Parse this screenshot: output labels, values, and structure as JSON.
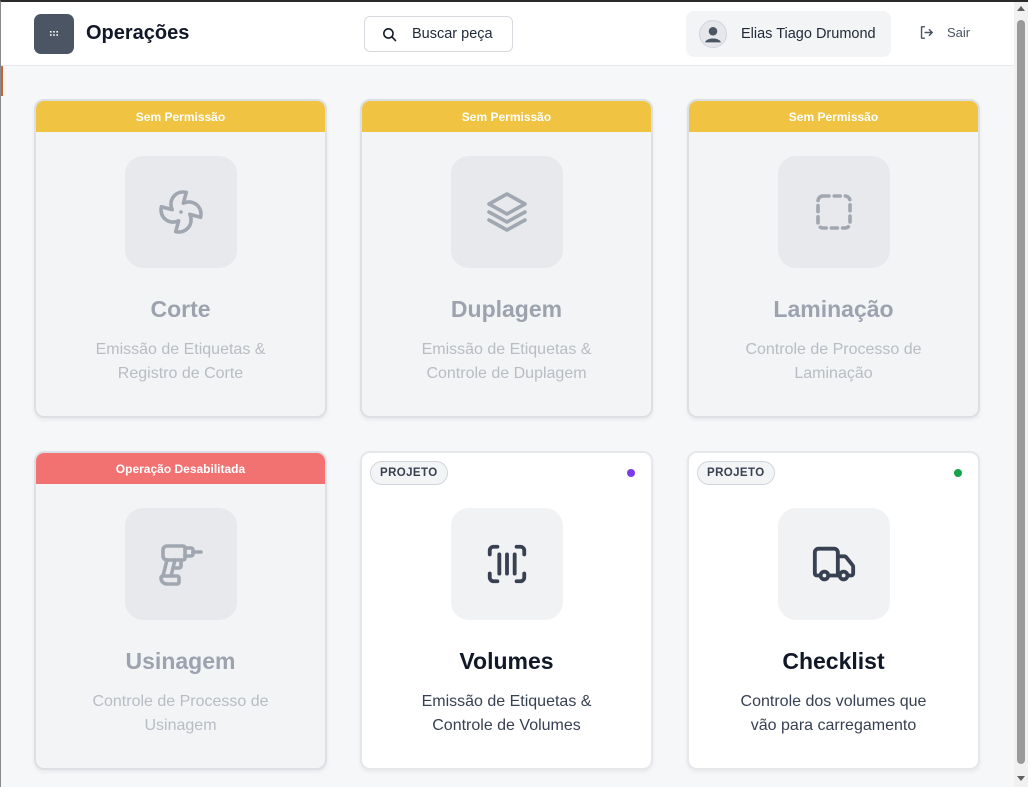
{
  "header": {
    "title": "Operações",
    "search_label": "Buscar peça",
    "user_name": "Elias Tiago Drumond",
    "logout_label": "Sair"
  },
  "colors": {
    "warning_banner": "#f0c343",
    "danger_banner": "#f27272",
    "dot_purple": "#7c3aed",
    "dot_green": "#16a34a"
  },
  "cards": [
    {
      "title": "Corte",
      "desc_line1": "Emissão de Etiquetas &",
      "desc_line2": "Registro de Corte",
      "banner": "Sem Permissão",
      "icon": "fan-icon",
      "enabled": false
    },
    {
      "title": "Duplagem",
      "desc_line1": "Emissão de Etiquetas &",
      "desc_line2": "Controle de Duplagem",
      "banner": "Sem Permissão",
      "icon": "layers-icon",
      "enabled": false
    },
    {
      "title": "Laminação",
      "desc_line1": "Controle de Processo de",
      "desc_line2": "Laminação",
      "banner": "Sem Permissão",
      "icon": "dashed-square-icon",
      "enabled": false
    },
    {
      "title": "Usinagem",
      "desc_line1": "Controle de Processo de",
      "desc_line2": "Usinagem",
      "banner": "Operação Desabilitada",
      "icon": "drill-icon",
      "enabled": false
    },
    {
      "title": "Volumes",
      "desc_line1": "Emissão de Etiquetas &",
      "desc_line2": "Controle de Volumes",
      "badge": "PROJETO",
      "icon": "barcode-scan-icon",
      "enabled": true
    },
    {
      "title": "Checklist",
      "desc_line1": "Controle dos volumes que",
      "desc_line2": "vão para carregamento",
      "badge": "PROJETO",
      "icon": "truck-icon",
      "enabled": true
    }
  ]
}
